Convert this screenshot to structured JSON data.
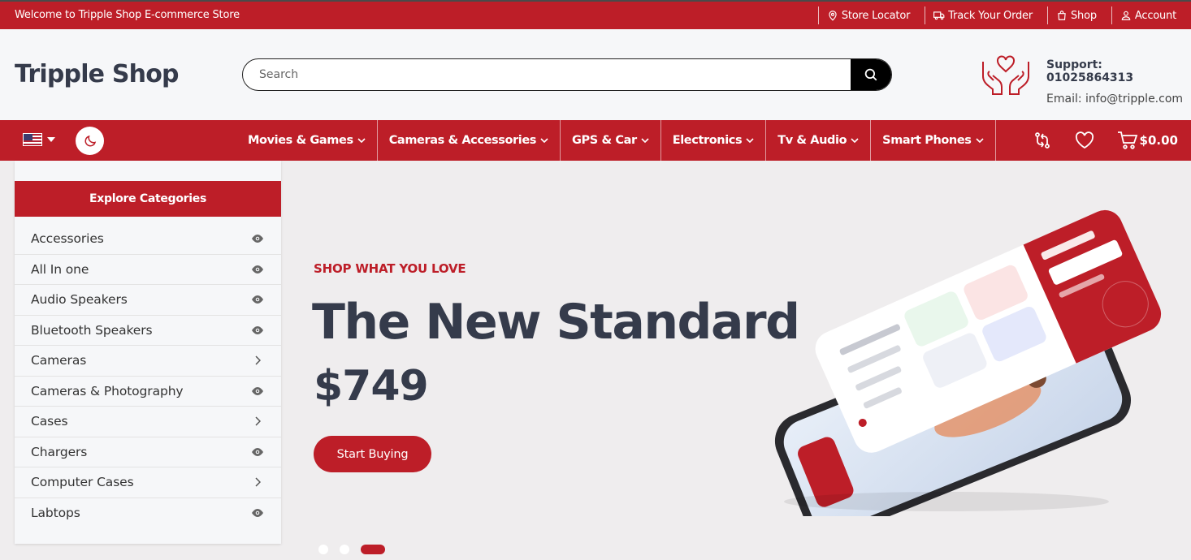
{
  "topbar": {
    "welcome": "Welcome to Tripple Shop E-commerce Store",
    "links": [
      {
        "label": "Store Locator",
        "icon": "map-pin-icon"
      },
      {
        "label": "Track Your Order",
        "icon": "truck-icon"
      },
      {
        "label": "Shop",
        "icon": "shopping-bag-icon"
      },
      {
        "label": "Account",
        "icon": "user-icon"
      }
    ]
  },
  "header": {
    "logo": "Tripple Shop",
    "search_placeholder": "Search",
    "support_phone": "Support: 01025864313",
    "support_email": "Email: info@tripple.com"
  },
  "nav": {
    "menu": [
      {
        "label": "Movies & Games"
      },
      {
        "label": "Cameras & Accessories"
      },
      {
        "label": "GPS & Car"
      },
      {
        "label": "Electronics"
      },
      {
        "label": "Tv & Audio"
      },
      {
        "label": "Smart Phones"
      }
    ],
    "cart_total": "$0.00"
  },
  "sidebar": {
    "title": "Explore Categories",
    "items": [
      {
        "label": "Accessories",
        "icon": "eye-icon"
      },
      {
        "label": "All In one",
        "icon": "eye-icon"
      },
      {
        "label": "Audio Speakers",
        "icon": "eye-icon"
      },
      {
        "label": "Bluetooth Speakers",
        "icon": "eye-icon"
      },
      {
        "label": "Cameras",
        "icon": "chevron-right-icon"
      },
      {
        "label": "Cameras & Photography",
        "icon": "eye-icon"
      },
      {
        "label": "Cases",
        "icon": "chevron-right-icon"
      },
      {
        "label": "Chargers",
        "icon": "eye-icon"
      },
      {
        "label": "Computer Cases",
        "icon": "chevron-right-icon"
      },
      {
        "label": "Labtops",
        "icon": "eye-icon"
      }
    ]
  },
  "hero": {
    "subtitle": "SHOP WHAT YOU LOVE",
    "title": "The New Standard",
    "price": "$749",
    "button": "Start Buying",
    "slides": 3,
    "active_slide": 3
  },
  "colors": {
    "brand_red": "#bd1e28",
    "dark_text": "#353b4b",
    "background": "#efedee"
  }
}
